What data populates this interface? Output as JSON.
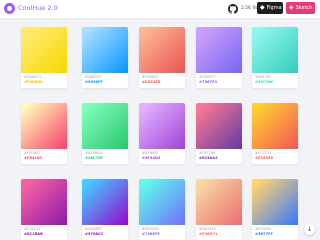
{
  "header": {
    "brand": "CoolHue 2.0",
    "stars": "2.5K Stars",
    "figma_label": "Figma",
    "sketch_label": "Sketch"
  },
  "cards": [
    {
      "from": "#FDEB71",
      "to": "#F8D800",
      "label1": "#FDEB71",
      "label2": "#F8D800",
      "c2": "#f2c200"
    },
    {
      "from": "#ABDCFF",
      "to": "#0396FF",
      "label1": "#ABDCFF",
      "label2": "#0396FF",
      "c2": "#0396FF"
    },
    {
      "from": "#FEB692",
      "to": "#EA5455",
      "label1": "#FEB692",
      "label2": "#EA5455",
      "c2": "#EA5455"
    },
    {
      "from": "#CE9FFC",
      "to": "#7367F0",
      "label1": "#CE9FFC",
      "label2": "#7367F0",
      "c2": "#7367F0"
    },
    {
      "from": "#90F7EC",
      "to": "#32CCBC",
      "label1": "#90F7EC",
      "label2": "#32CCBC",
      "c2": "#32CCBC"
    },
    {
      "from": "#FFF6B7",
      "to": "#F6416C",
      "label1": "#FFF6B7",
      "label2": "#F6416C",
      "c2": "#F6416C"
    },
    {
      "from": "#81FBB8",
      "to": "#28C76F",
      "label1": "#81FBB8",
      "label2": "#28C76F",
      "c2": "#28C76F"
    },
    {
      "from": "#E2B0FF",
      "to": "#9F44D3",
      "label1": "#E2B0FF",
      "label2": "#9F44D3",
      "c2": "#9F44D3"
    },
    {
      "from": "#F97794",
      "to": "#623AA2",
      "label1": "#F97794",
      "label2": "#623AA2",
      "c2": "#623AA2"
    },
    {
      "from": "#FCCF31",
      "to": "#F55555",
      "label1": "#FCCF31",
      "label2": "#F55555",
      "c2": "#F55555"
    },
    {
      "from": "#F761A1",
      "to": "#8C1BAB",
      "label1": "#F761A1",
      "label2": "#8C1BAB",
      "c2": "#8C1BAB"
    },
    {
      "from": "#43CBFF",
      "to": "#9708CC",
      "label1": "#43CBFF",
      "label2": "#9708CC",
      "c2": "#9708CC"
    },
    {
      "from": "#5EFCE8",
      "to": "#736EFE",
      "label1": "#5EFCE8",
      "label2": "#736EFE",
      "c2": "#736EFE"
    },
    {
      "from": "#FAD7A1",
      "to": "#E96D71",
      "label1": "#FAD7A1",
      "label2": "#E96D71",
      "c2": "#E96D71"
    },
    {
      "from": "#FFD26F",
      "to": "#3677FF",
      "label1": "#FFD26F",
      "label2": "#3677FF",
      "c2": "#3677FF"
    }
  ],
  "scroll_top_icon": "arrow-down-icon"
}
